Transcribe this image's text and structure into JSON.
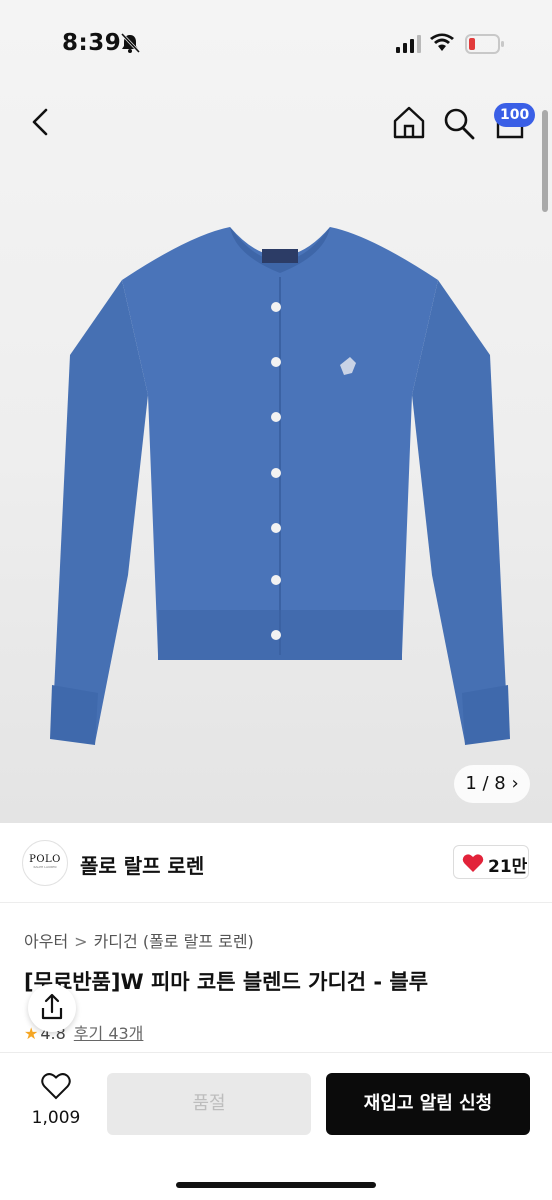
{
  "status_bar": {
    "time": "8:39"
  },
  "header": {
    "cart_count": "100"
  },
  "gallery": {
    "pager": "1 / 8 ›"
  },
  "brand": {
    "logo_text": "POLO",
    "logo_sub": "RALPH LAUREN",
    "name": "폴로 랄프 로렌",
    "likes": "21만"
  },
  "breadcrumb": {
    "level1": "아우터",
    "separator": ">",
    "level2": "카디건 (폴로 랄프 로렌)"
  },
  "product": {
    "title": "[무료반품]W 피마 코튼 블렌드 가디건 - 블루",
    "rating": "4.8",
    "reviews": "후기 43개"
  },
  "bottom_bar": {
    "wish_count": "1,009",
    "soldout_label": "품절",
    "restock_label": "재입고 알림 신청"
  },
  "colors": {
    "cardigan_blue": "#4a73b8",
    "badge_blue": "#3a5fe6",
    "heart_red": "#e2233a"
  }
}
